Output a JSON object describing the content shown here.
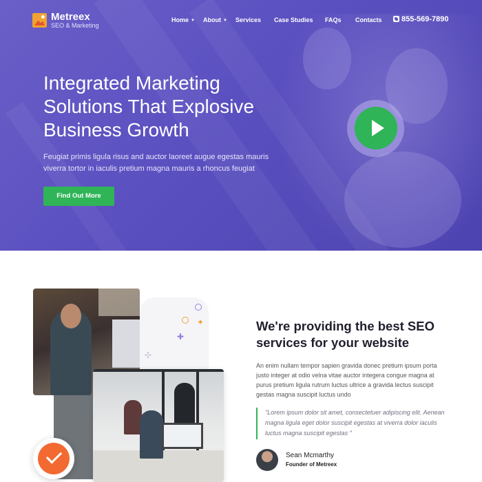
{
  "brand": {
    "name": "Metreex",
    "tagline": "SEO & Marketing"
  },
  "nav": {
    "items": [
      {
        "label": "Home",
        "has_dropdown": true
      },
      {
        "label": "About",
        "has_dropdown": true
      },
      {
        "label": "Services",
        "has_dropdown": false
      },
      {
        "label": "Case Studies",
        "has_dropdown": false
      },
      {
        "label": "FAQs",
        "has_dropdown": false
      },
      {
        "label": "Contacts",
        "has_dropdown": false
      }
    ],
    "phone": "855-569-7890",
    "phone_icon": "phone-icon"
  },
  "hero": {
    "title": "Integrated Marketing Solutions That Explosive Business Growth",
    "text": "Feugiat primis ligula risus and auctor laoreet augue egestas mauris viverra tortor in iaculis pretium magna mauris a rhoncus feugiat",
    "button_label": "Find Out More",
    "play_icon": "play-icon"
  },
  "about": {
    "title": "We're providing the best SEO services for your website",
    "text": "An enim nullam tempor sapien gravida donec pretium ipsum porta justo integer at odio velna vitae auctor integera congue magna at purus pretium ligula rutrum luctus ultrice a gravida lectus suscipit gestas magna suscipit luctus undo",
    "quote": "\"Lorem ipsum dolor sit amet, consectetuer adipiscing elit. Aenean magna ligula eget dolor suscipit egestas at viverra dolor iaculis luctus magna suscipit egestas \"",
    "author_name": "Sean Mcmarthy",
    "author_role": "Founder of Metreex",
    "badge_icon": "check-icon"
  },
  "colors": {
    "hero_bg": "#5b50c0",
    "accent_green": "#2fb457",
    "accent_orange": "#f26a32",
    "heading": "#1f1f2e"
  }
}
